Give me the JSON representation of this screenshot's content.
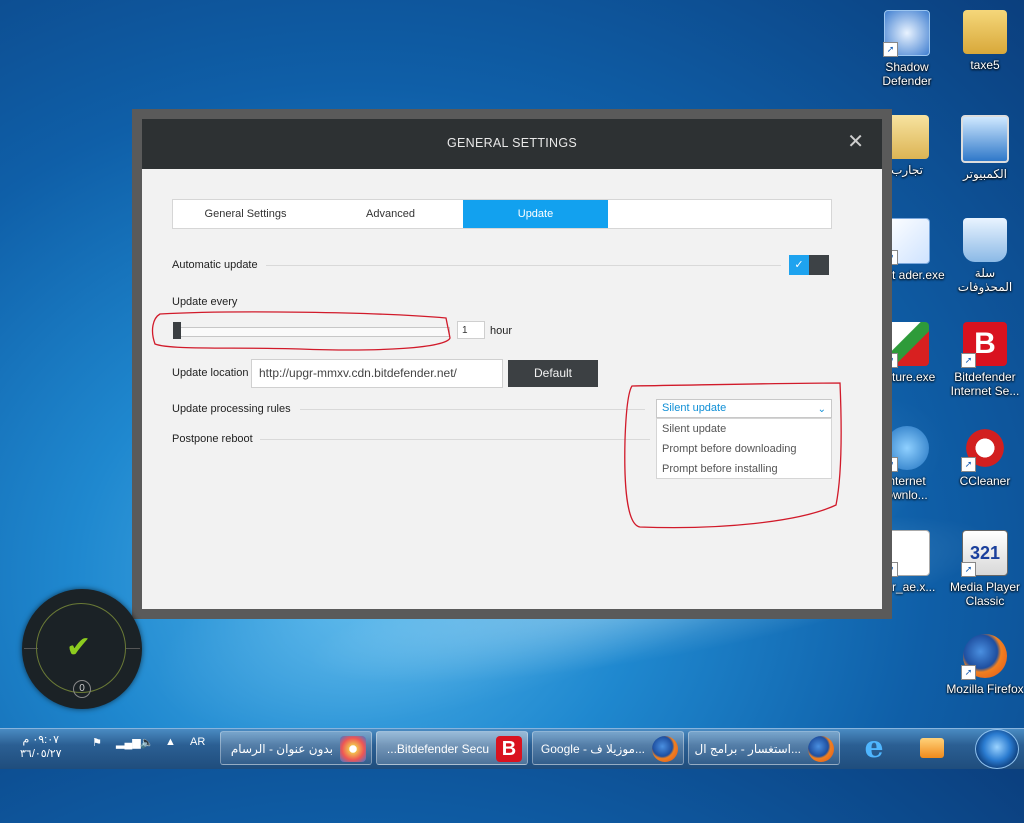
{
  "desktop": {
    "icons": [
      {
        "label": "Shadow Defender",
        "icon": "shield-icon"
      },
      {
        "label": "taxe5",
        "icon": "user-folder-icon"
      },
      {
        "label": "تجارب",
        "icon": "folder-icon"
      },
      {
        "label": "الكمبيوتر",
        "icon": "computer-icon"
      },
      {
        "label": "Foxit ader.exe",
        "icon": "foxit-icon"
      },
      {
        "label": "سلة المحذوفات",
        "icon": "recycle-bin-icon"
      },
      {
        "label": "apture.exe",
        "icon": "capture-icon"
      },
      {
        "label": "Bitdefender Internet Se...",
        "icon": "bitdefender-icon"
      },
      {
        "label": "nternet ownlo...",
        "icon": "download-manager-icon"
      },
      {
        "label": "CCleaner",
        "icon": "ccleaner-icon"
      },
      {
        "label": "_ar_ae.x...",
        "icon": "document-icon"
      },
      {
        "label": "Media Player Classic",
        "icon": "media-player-icon"
      },
      {
        "label": "Mozilla Firefox",
        "icon": "firefox-icon"
      }
    ]
  },
  "dialog": {
    "title": "GENERAL SETTINGS",
    "close": "✕",
    "tabs": [
      {
        "label": "General Settings",
        "active": false
      },
      {
        "label": "Advanced",
        "active": false
      },
      {
        "label": "Update",
        "active": true
      }
    ],
    "automatic_update": {
      "label": "Automatic update",
      "checked": true,
      "check_glyph": "✓"
    },
    "update_every": {
      "label": "Update every",
      "value": "1",
      "unit": "hour",
      "slider_fraction": 0.0
    },
    "update_location": {
      "label": "Update location",
      "value": "http://upgr-mmxv.cdn.bitdefender.net/",
      "default_button": "Default"
    },
    "update_processing_rules": {
      "label": "Update processing rules",
      "selected": "Silent update",
      "options": [
        "Silent update",
        "Prompt before downloading",
        "Prompt before installing"
      ]
    },
    "postpone_reboot": {
      "label": "Postpone reboot"
    }
  },
  "widget": {
    "count": "0",
    "status_glyph": "✔"
  },
  "taskbar": {
    "language": "AR",
    "clock_time": "٠٩:٠٧ م",
    "clock_date": "٣٦/٠٥/٢٧",
    "windows": [
      {
        "label": "بدون عنوان - الرسام",
        "icon": "paint-icon"
      },
      {
        "label": "...Bitdefender Secu",
        "icon": "bitdefender-icon",
        "active": true
      },
      {
        "label": "Google - موزيلا ف...",
        "icon": "firefox-icon"
      },
      {
        "label": "استغسار - برامج ال...",
        "icon": "firefox-icon"
      }
    ],
    "pinned": [
      "internet-explorer-icon",
      "media-player-icon"
    ],
    "colors": {
      "accent": "#12a1ef",
      "annotation": "#d11a2a",
      "bitdefender": "#d9121f"
    }
  }
}
